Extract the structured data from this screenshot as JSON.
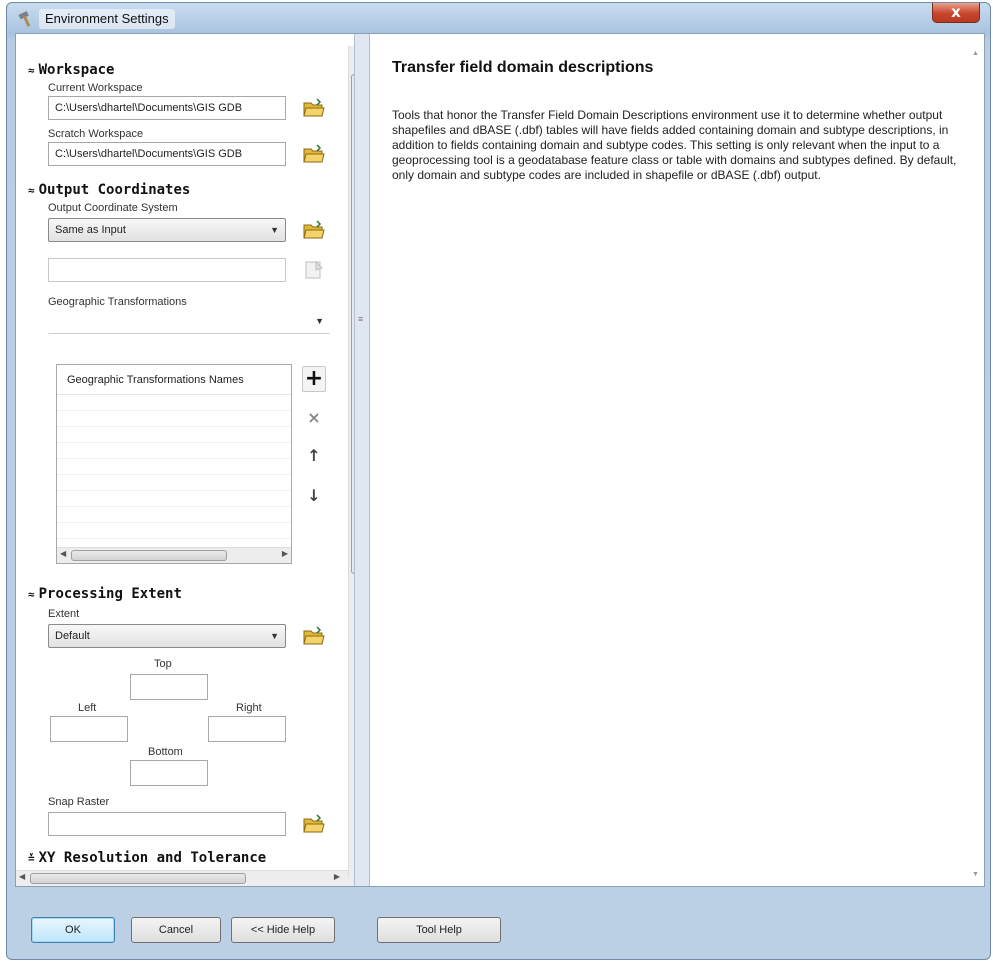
{
  "window": {
    "title": "Environment Settings",
    "close_glyph": "x"
  },
  "workspace": {
    "header": "Workspace",
    "current_label": "Current Workspace",
    "current_value": "C:\\Users\\dhartel\\Documents\\GIS GDB",
    "scratch_label": "Scratch Workspace",
    "scratch_value": "C:\\Users\\dhartel\\Documents\\GIS GDB"
  },
  "output_coordinates": {
    "header": "Output Coordinates",
    "system_label": "Output Coordinate System",
    "system_value": "Same as Input",
    "transform_label": "Geographic Transformations",
    "list_header": "Geographic Transformations Names"
  },
  "processing_extent": {
    "header": "Processing Extent",
    "extent_label": "Extent",
    "extent_value": "Default",
    "top_label": "Top",
    "left_label": "Left",
    "right_label": "Right",
    "bottom_label": "Bottom",
    "snap_label": "Snap Raster"
  },
  "xy_resolution": {
    "header": "XY Resolution and Tolerance"
  },
  "help": {
    "title": "Transfer field domain descriptions",
    "body": "Tools that honor the Transfer Field Domain Descriptions environment use it to determine whether output shapefiles and dBASE (.dbf) tables will have fields added containing domain and subtype descriptions, in addition to fields containing domain and subtype codes. This setting is only relevant when the input to a geoprocessing tool is a geodatabase feature class or table with domains and subtypes defined. By default, only domain and subtype codes are included in shapefile or dBASE (.dbf) output."
  },
  "buttons": {
    "ok": "OK",
    "cancel": "Cancel",
    "hide_help": "<< Hide Help",
    "tool_help": "Tool Help"
  },
  "icons": {
    "folder": "folder-open-icon",
    "properties": "properties-icon",
    "add": "+",
    "remove": "×",
    "move_up": "↑",
    "move_down": "↓",
    "collapse": "≈",
    "expand": "≚"
  }
}
